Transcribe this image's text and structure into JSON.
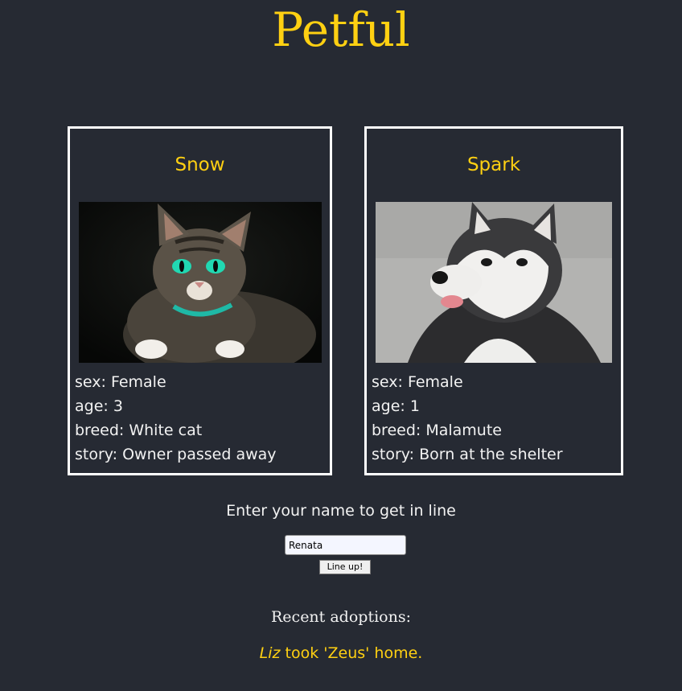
{
  "header": {
    "title": "Petful"
  },
  "pets": [
    {
      "name": "Snow",
      "photo": "cat-photo",
      "sex_label": "sex: ",
      "sex": "Female",
      "age_label": "age: ",
      "age": "3",
      "breed_label": "breed: ",
      "breed": "White cat",
      "story_label": "story: ",
      "story": "Owner passed away"
    },
    {
      "name": "Spark",
      "photo": "dog-photo",
      "sex_label": "sex: ",
      "sex": "Female",
      "age_label": "age: ",
      "age": "1",
      "breed_label": "breed: ",
      "breed": "Malamute",
      "story_label": "story: ",
      "story": "Born at the shelter"
    }
  ],
  "queue": {
    "prompt": "Enter your name to get in line",
    "name_value": "Renata",
    "button_label": "Line up!"
  },
  "adoptions": {
    "heading": "Recent adoptions:",
    "items": [
      {
        "adopter": "Liz",
        "text": " took 'Zeus' home."
      }
    ]
  },
  "colors": {
    "background": "#262a33",
    "accent": "#ffd012",
    "text": "#f2f2f2",
    "card_border": "#ffffff"
  }
}
